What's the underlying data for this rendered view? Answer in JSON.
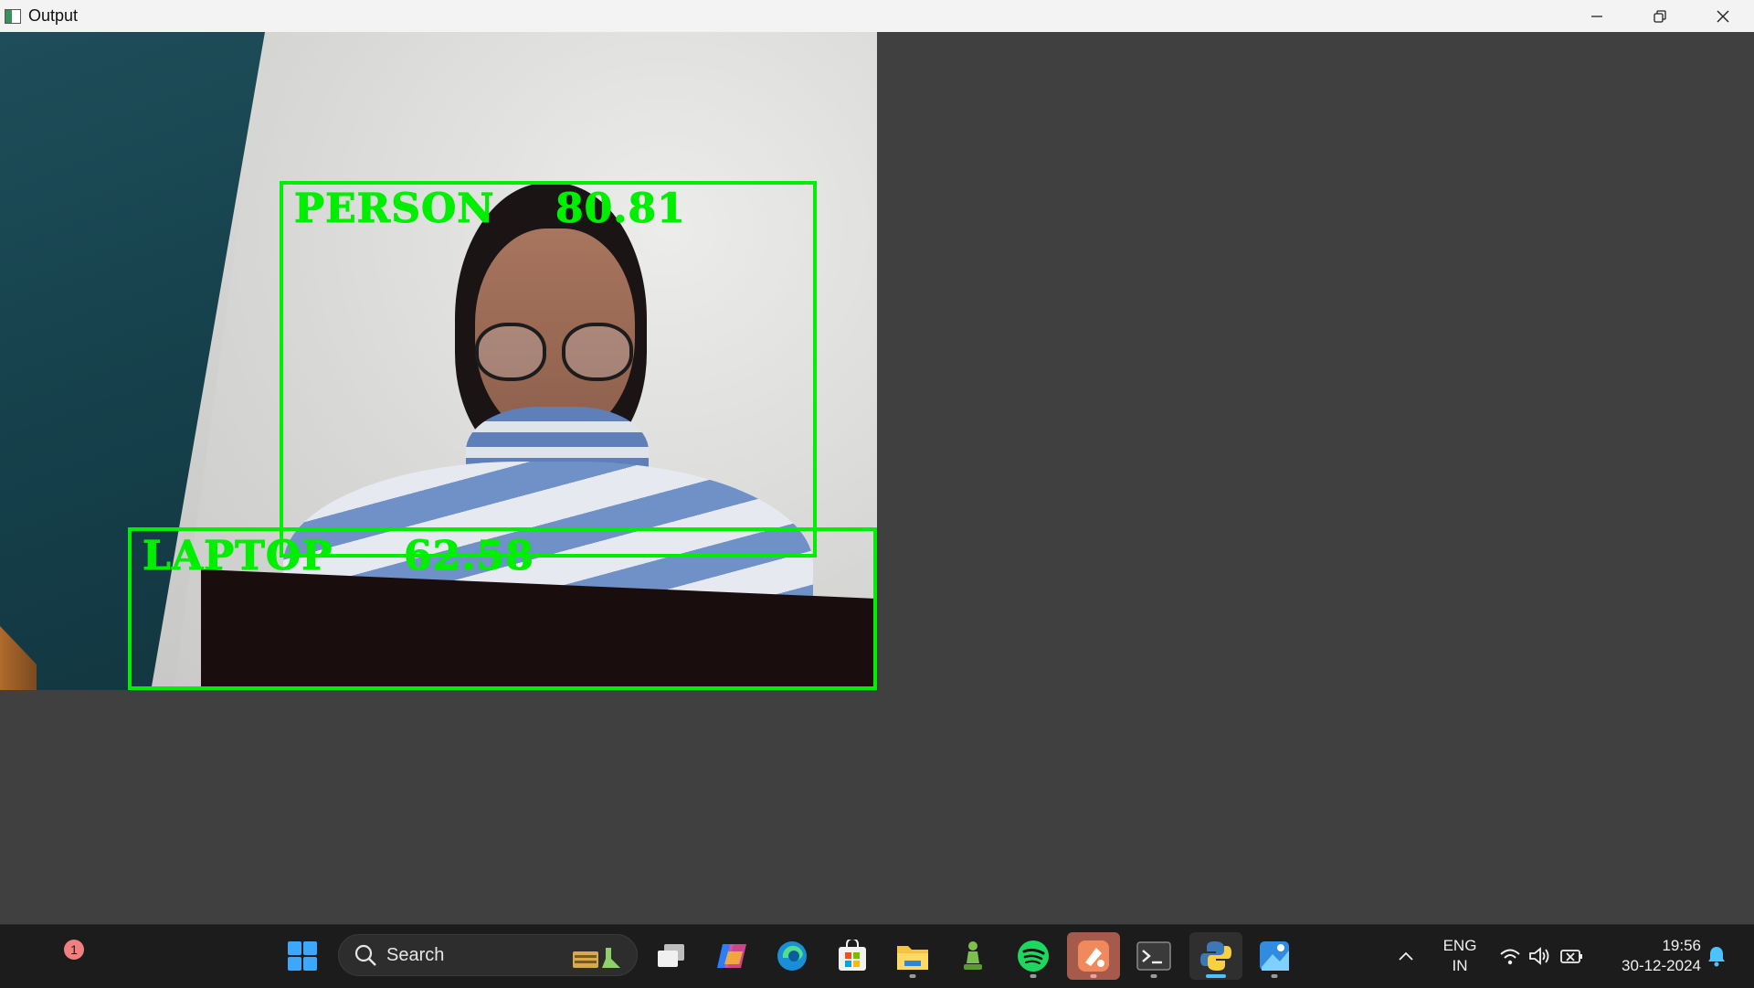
{
  "window": {
    "title": "Output",
    "controls": [
      "minimize-icon",
      "restore-icon",
      "close-icon"
    ]
  },
  "detections": [
    {
      "label": "PERSON",
      "score": "80.81",
      "color": "#00ee00"
    },
    {
      "label": "LAPTOP",
      "score": "62.58",
      "color": "#00ee00"
    }
  ],
  "taskbar": {
    "widgets_badge": "1",
    "search": {
      "placeholder": "Search"
    },
    "pinned": [
      "start-icon",
      "task-view-icon",
      "copilot-icon",
      "edge-icon",
      "store-icon",
      "file-explorer-icon",
      "chess-icon",
      "spotify-icon",
      "app-icon",
      "terminal-icon",
      "python-icon",
      "photos-icon"
    ],
    "tray": {
      "language": "ENG",
      "region": "IN",
      "time": "19:56",
      "date": "30-12-2024"
    }
  },
  "colors": {
    "detection_box": "#00ee00",
    "window_background": "#404040",
    "taskbar": "#1c1c1c"
  }
}
